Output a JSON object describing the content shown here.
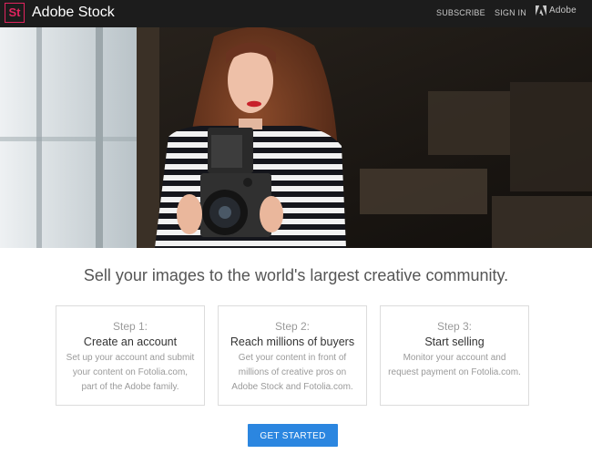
{
  "header": {
    "logo_text": "St",
    "brand": "Adobe Stock",
    "nav": {
      "subscribe": "SUBSCRIBE",
      "sign_in": "SIGN IN",
      "adobe": "Adobe"
    },
    "icons": [
      "adobe-logo-icon"
    ],
    "colors": {
      "bar": "#1c1c1c",
      "logo_accent": "#e0245e"
    }
  },
  "hero": {
    "image_subject": "woman holding a medium-format camera by a window"
  },
  "main": {
    "headline": "Sell your images to the world's largest creative community.",
    "steps": [
      {
        "number": "Step 1:",
        "title": "Create an account",
        "description": "Set up your account and submit your content on Fotolia.com, part of the Adobe family."
      },
      {
        "number": "Step 2:",
        "title": "Reach millions of buyers",
        "description": "Get your content in front of millions of creative pros on Adobe Stock and Fotolia.com."
      },
      {
        "number": "Step 3:",
        "title": "Start selling",
        "description": "Monitor your account and request payment on Fotolia.com."
      }
    ],
    "cta_label": "GET STARTED",
    "colors": {
      "cta": "#2b86e0"
    }
  }
}
